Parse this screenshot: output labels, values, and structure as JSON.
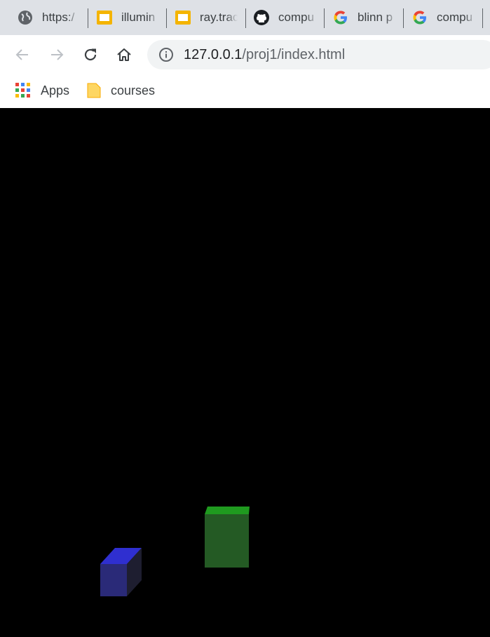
{
  "tabs": [
    {
      "label": "https:/",
      "icon": "globe-icon"
    },
    {
      "label": "illumin",
      "icon": "slides-icon"
    },
    {
      "label": "ray.trac",
      "icon": "slides-icon"
    },
    {
      "label": "compu",
      "icon": "github-icon"
    },
    {
      "label": "blinn p",
      "icon": "google-icon"
    },
    {
      "label": "compu",
      "icon": "google-icon"
    }
  ],
  "toolbar": {
    "url_host": "127.0.0.1",
    "url_path": "/proj1/index.html"
  },
  "bookmarks": [
    {
      "label": "Apps",
      "icon": "apps-grid-icon"
    },
    {
      "label": "courses",
      "icon": "folder-icon"
    }
  ],
  "scene": {
    "background": "#000000",
    "objects": [
      {
        "name": "blue cube",
        "top_color": "#2f2fd0",
        "front_color": "#2a2a78",
        "side_color": "#1e1e30"
      },
      {
        "name": "green box",
        "top_color": "#1f9a1f",
        "front_color": "#245a24"
      }
    ]
  }
}
